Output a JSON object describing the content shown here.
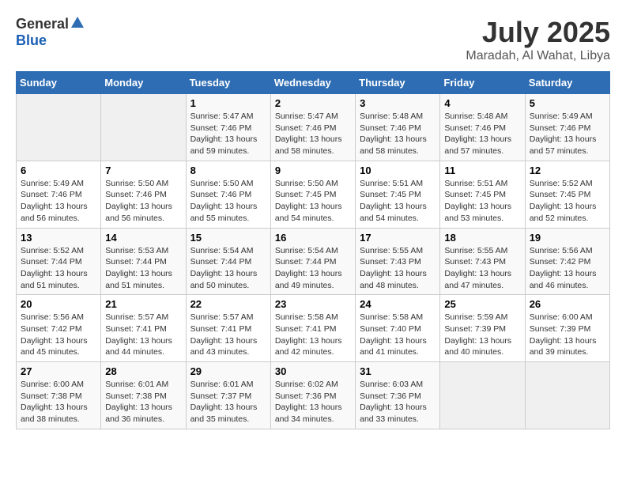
{
  "header": {
    "logo_general": "General",
    "logo_blue": "Blue",
    "title": "July 2025",
    "location": "Maradah, Al Wahat, Libya"
  },
  "weekdays": [
    "Sunday",
    "Monday",
    "Tuesday",
    "Wednesday",
    "Thursday",
    "Friday",
    "Saturday"
  ],
  "weeks": [
    [
      {
        "day": "",
        "info": ""
      },
      {
        "day": "",
        "info": ""
      },
      {
        "day": "1",
        "info": "Sunrise: 5:47 AM\nSunset: 7:46 PM\nDaylight: 13 hours and 59 minutes."
      },
      {
        "day": "2",
        "info": "Sunrise: 5:47 AM\nSunset: 7:46 PM\nDaylight: 13 hours and 58 minutes."
      },
      {
        "day": "3",
        "info": "Sunrise: 5:48 AM\nSunset: 7:46 PM\nDaylight: 13 hours and 58 minutes."
      },
      {
        "day": "4",
        "info": "Sunrise: 5:48 AM\nSunset: 7:46 PM\nDaylight: 13 hours and 57 minutes."
      },
      {
        "day": "5",
        "info": "Sunrise: 5:49 AM\nSunset: 7:46 PM\nDaylight: 13 hours and 57 minutes."
      }
    ],
    [
      {
        "day": "6",
        "info": "Sunrise: 5:49 AM\nSunset: 7:46 PM\nDaylight: 13 hours and 56 minutes."
      },
      {
        "day": "7",
        "info": "Sunrise: 5:50 AM\nSunset: 7:46 PM\nDaylight: 13 hours and 56 minutes."
      },
      {
        "day": "8",
        "info": "Sunrise: 5:50 AM\nSunset: 7:46 PM\nDaylight: 13 hours and 55 minutes."
      },
      {
        "day": "9",
        "info": "Sunrise: 5:50 AM\nSunset: 7:45 PM\nDaylight: 13 hours and 54 minutes."
      },
      {
        "day": "10",
        "info": "Sunrise: 5:51 AM\nSunset: 7:45 PM\nDaylight: 13 hours and 54 minutes."
      },
      {
        "day": "11",
        "info": "Sunrise: 5:51 AM\nSunset: 7:45 PM\nDaylight: 13 hours and 53 minutes."
      },
      {
        "day": "12",
        "info": "Sunrise: 5:52 AM\nSunset: 7:45 PM\nDaylight: 13 hours and 52 minutes."
      }
    ],
    [
      {
        "day": "13",
        "info": "Sunrise: 5:52 AM\nSunset: 7:44 PM\nDaylight: 13 hours and 51 minutes."
      },
      {
        "day": "14",
        "info": "Sunrise: 5:53 AM\nSunset: 7:44 PM\nDaylight: 13 hours and 51 minutes."
      },
      {
        "day": "15",
        "info": "Sunrise: 5:54 AM\nSunset: 7:44 PM\nDaylight: 13 hours and 50 minutes."
      },
      {
        "day": "16",
        "info": "Sunrise: 5:54 AM\nSunset: 7:44 PM\nDaylight: 13 hours and 49 minutes."
      },
      {
        "day": "17",
        "info": "Sunrise: 5:55 AM\nSunset: 7:43 PM\nDaylight: 13 hours and 48 minutes."
      },
      {
        "day": "18",
        "info": "Sunrise: 5:55 AM\nSunset: 7:43 PM\nDaylight: 13 hours and 47 minutes."
      },
      {
        "day": "19",
        "info": "Sunrise: 5:56 AM\nSunset: 7:42 PM\nDaylight: 13 hours and 46 minutes."
      }
    ],
    [
      {
        "day": "20",
        "info": "Sunrise: 5:56 AM\nSunset: 7:42 PM\nDaylight: 13 hours and 45 minutes."
      },
      {
        "day": "21",
        "info": "Sunrise: 5:57 AM\nSunset: 7:41 PM\nDaylight: 13 hours and 44 minutes."
      },
      {
        "day": "22",
        "info": "Sunrise: 5:57 AM\nSunset: 7:41 PM\nDaylight: 13 hours and 43 minutes."
      },
      {
        "day": "23",
        "info": "Sunrise: 5:58 AM\nSunset: 7:41 PM\nDaylight: 13 hours and 42 minutes."
      },
      {
        "day": "24",
        "info": "Sunrise: 5:58 AM\nSunset: 7:40 PM\nDaylight: 13 hours and 41 minutes."
      },
      {
        "day": "25",
        "info": "Sunrise: 5:59 AM\nSunset: 7:39 PM\nDaylight: 13 hours and 40 minutes."
      },
      {
        "day": "26",
        "info": "Sunrise: 6:00 AM\nSunset: 7:39 PM\nDaylight: 13 hours and 39 minutes."
      }
    ],
    [
      {
        "day": "27",
        "info": "Sunrise: 6:00 AM\nSunset: 7:38 PM\nDaylight: 13 hours and 38 minutes."
      },
      {
        "day": "28",
        "info": "Sunrise: 6:01 AM\nSunset: 7:38 PM\nDaylight: 13 hours and 36 minutes."
      },
      {
        "day": "29",
        "info": "Sunrise: 6:01 AM\nSunset: 7:37 PM\nDaylight: 13 hours and 35 minutes."
      },
      {
        "day": "30",
        "info": "Sunrise: 6:02 AM\nSunset: 7:36 PM\nDaylight: 13 hours and 34 minutes."
      },
      {
        "day": "31",
        "info": "Sunrise: 6:03 AM\nSunset: 7:36 PM\nDaylight: 13 hours and 33 minutes."
      },
      {
        "day": "",
        "info": ""
      },
      {
        "day": "",
        "info": ""
      }
    ]
  ]
}
